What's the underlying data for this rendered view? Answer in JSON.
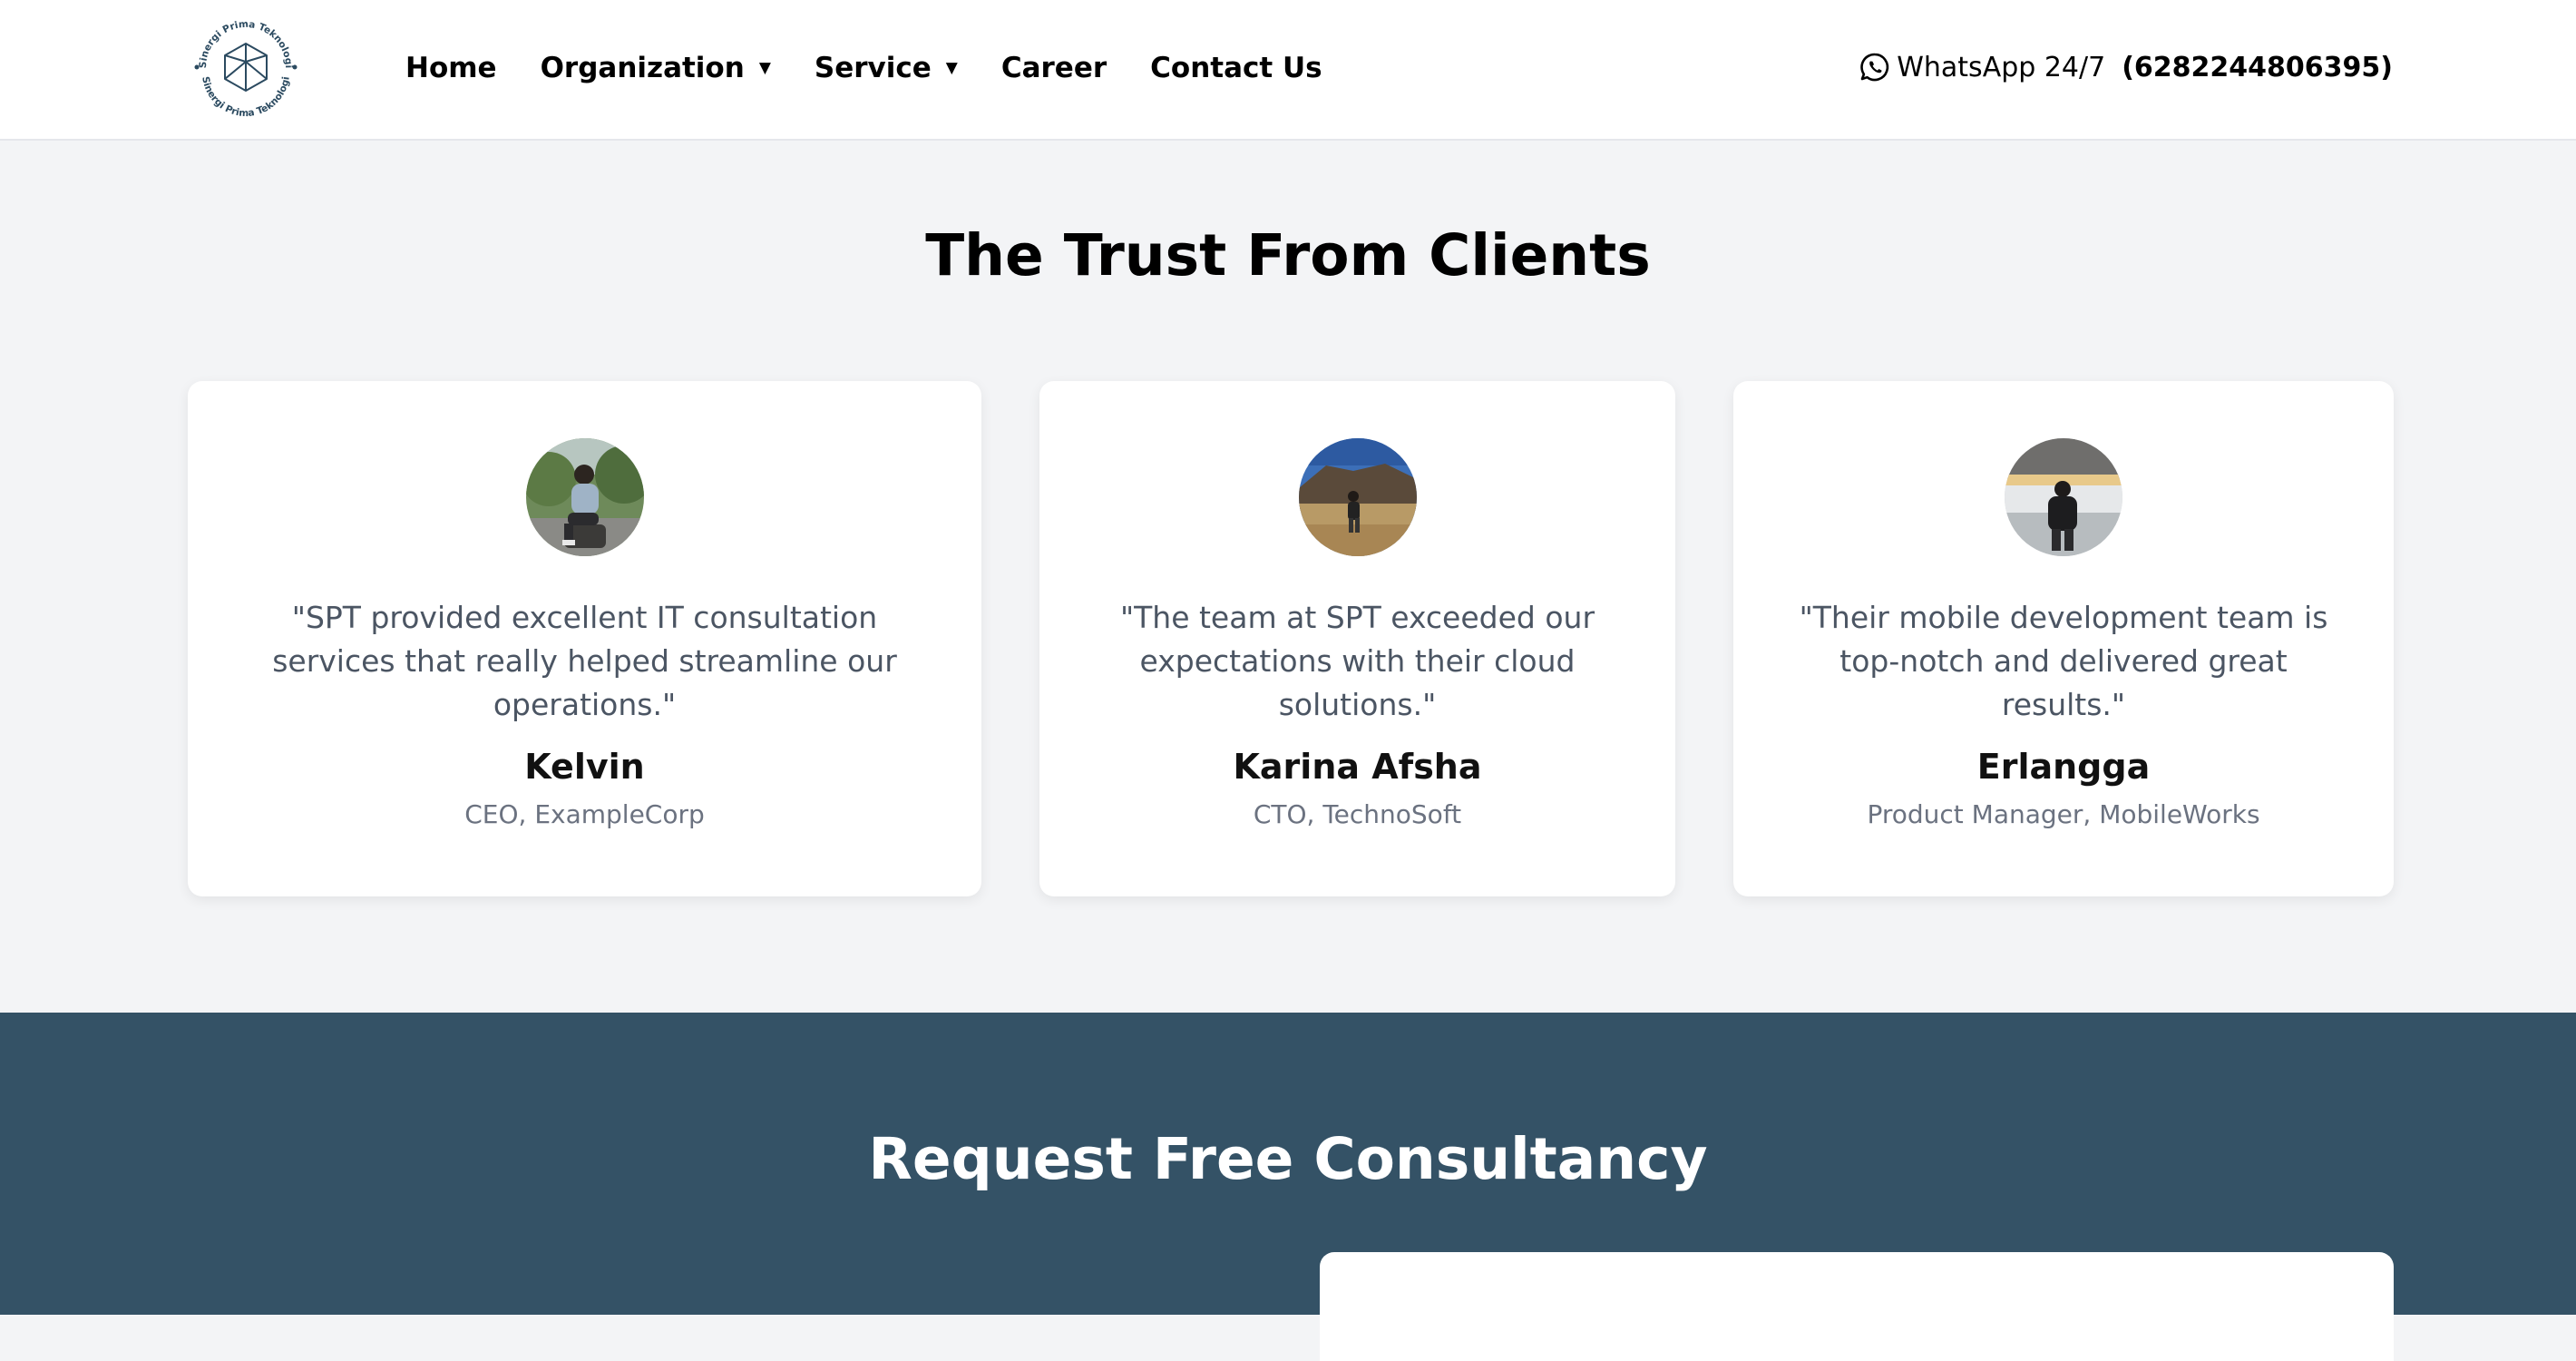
{
  "header": {
    "logo_text": "Sinergi Prima Teknologi",
    "nav": [
      {
        "label": "Home",
        "has_dropdown": false
      },
      {
        "label": "Organization",
        "has_dropdown": true
      },
      {
        "label": "Service",
        "has_dropdown": true
      },
      {
        "label": "Career",
        "has_dropdown": false
      },
      {
        "label": "Contact Us",
        "has_dropdown": false
      }
    ],
    "whatsapp_label": "WhatsApp 24/7",
    "whatsapp_number": "(6282244806395)",
    "caret": "▼"
  },
  "testimonials": {
    "title_bold": "The Trust",
    "title_rest": "From Clients",
    "items": [
      {
        "quote": "\"SPT provided excellent IT consultation services that really helped streamline our operations.\"",
        "name": "Kelvin",
        "role": "CEO, ExampleCorp"
      },
      {
        "quote": "\"The team at SPT exceeded our expectations with their cloud solutions.\"",
        "name": "Karina Afsha",
        "role": "CTO, TechnoSoft"
      },
      {
        "quote": "\"Their mobile development team is top-notch and delivered great results.\"",
        "name": "Erlangga",
        "role": "Product Manager, MobileWorks"
      }
    ]
  },
  "cta": {
    "title_bold": "Request Free",
    "title_rest": "Consultancy"
  },
  "colors": {
    "cta_background": "#345266",
    "page_background": "#f3f4f6",
    "logo_accent": "#2b4a60"
  }
}
